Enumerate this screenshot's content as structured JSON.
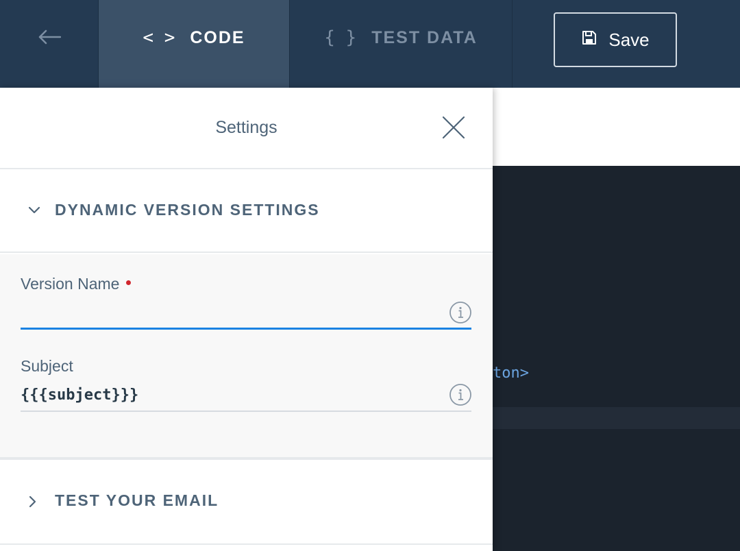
{
  "topbar": {
    "back_icon": "arrow-left-icon",
    "tabs": [
      {
        "label": "CODE",
        "glyph": "< >",
        "active": true
      },
      {
        "label": "TEST DATA",
        "glyph": "{ }",
        "active": false
      }
    ],
    "save_label": "Save",
    "save_icon": "floppy-disk-icon"
  },
  "settings": {
    "title": "Settings",
    "close_icon": "close-icon",
    "sections": [
      {
        "title": "DYNAMIC VERSION SETTINGS",
        "expanded": true,
        "icon": "chevron-down-icon"
      },
      {
        "title": "TEST YOUR EMAIL",
        "expanded": false,
        "icon": "chevron-right-icon"
      }
    ],
    "fields": {
      "version_name": {
        "label": "Version Name",
        "value": "",
        "required": true,
        "info_icon": "info-icon"
      },
      "subject": {
        "label": "Subject",
        "value": "{{{subject}}}",
        "info_icon": "info-icon"
      }
    }
  },
  "editor": {
    "visible_code": "ton>"
  },
  "colors": {
    "topbar": "#243a52",
    "active_tab": "#3b5168",
    "focus_underline": "#1a82e2",
    "required_dot": "#d0262d",
    "editor_bg": "#1b232d",
    "code_text": "#6ba4e0"
  }
}
